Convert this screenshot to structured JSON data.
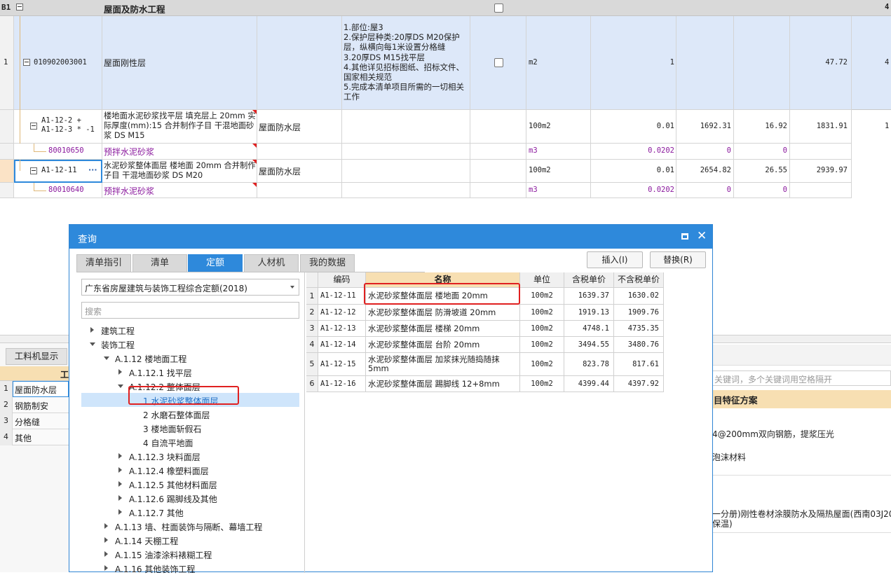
{
  "top_table": {
    "section": {
      "num": "B1",
      "name": "屋面及防水工程",
      "right_partial": "4"
    },
    "row1": {
      "num": "1",
      "code": "010902003001",
      "name": "屋面刚性层",
      "features": "1.部位:屋3\n2.保护层种类:20厚DS M20保护层，纵横向每1米设置分格缝\n3.20厚DS M15找平层\n4.其他详见招标图纸、招标文件、国家相关规范\n5.完成本清单项目所需的一切相关工作",
      "unit": "m2",
      "qty": "1",
      "price": "47.72",
      "right_partial": "4"
    },
    "row2": {
      "code": "A1-12-2 +\nA1-12-3 * -1",
      "name": "楼地面水泥砂浆找平层 填充层上 20mm 实际厚度(mm):15  合并制作子目 干混地面砂浆 DS M15",
      "spec": "屋面防水层",
      "unit": "100m2",
      "qty": "0.01",
      "p1": "1692.31",
      "p2": "16.92",
      "p3": "1831.91",
      "right_partial": "1"
    },
    "row3": {
      "code": "80010650",
      "name": "预拌水泥砂浆",
      "unit": "m3",
      "qty": "0.0202",
      "p1": "0",
      "p2": "0"
    },
    "row4": {
      "code": "A1-12-11",
      "more": "···",
      "name": "水泥砂浆整体面层 楼地面 20mm  合并制作子目 干混地面砂浆 DS M20",
      "spec": "屋面防水层",
      "unit": "100m2",
      "qty": "0.01",
      "p1": "2654.82",
      "p2": "26.55",
      "p3": "2939.97"
    },
    "row5": {
      "code": "80010640",
      "name": "预拌水泥砂浆",
      "unit": "m3",
      "qty": "0.0202",
      "p1": "0",
      "p2": "0"
    }
  },
  "lower_left": {
    "tab": "工料机显示",
    "header_partial": "工",
    "rows": [
      {
        "num": "1",
        "name": "屋面防水层"
      },
      {
        "num": "2",
        "name": "钢筋制安"
      },
      {
        "num": "3",
        "name": "分格缝"
      },
      {
        "num": "4",
        "name": "其他"
      }
    ]
  },
  "lower_right": {
    "search_hint": "关键词，多个关键词用空格隔开",
    "header": "目特征方案",
    "line1": "4@200mm双向钢筋，提浆压光",
    "line2": "泡沫材料",
    "line3": "一分册)刚性卷材涂膜防水及隔热屋面(西南03J201",
    "line4": "保温)"
  },
  "dialog": {
    "title": "查询",
    "tabs": [
      "清单指引",
      "清单",
      "定额",
      "人材机",
      "我的数据"
    ],
    "active_tab": 2,
    "insert_btn": "插入(I)",
    "replace_btn": "替换(R)",
    "norm_select": "广东省房屋建筑与装饰工程综合定额(2018)",
    "search_placeholder": "搜索",
    "tree": [
      {
        "label": "建筑工程",
        "level": 0,
        "state": "closed"
      },
      {
        "label": "装饰工程",
        "level": 0,
        "state": "open"
      },
      {
        "label": "A.1.12 楼地面工程",
        "level": 1,
        "state": "open"
      },
      {
        "label": "A.1.12.1 找平层",
        "level": 2,
        "state": "closed"
      },
      {
        "label": "A.1.12.2 整体面层",
        "level": 2,
        "state": "open"
      },
      {
        "label": "1 水泥砂浆整体面层",
        "level": 3,
        "state": "leaf",
        "selected": true
      },
      {
        "label": "2 水磨石整体面层",
        "level": 3,
        "state": "leaf"
      },
      {
        "label": "3 楼地面斩假石",
        "level": 3,
        "state": "leaf"
      },
      {
        "label": "4 自流平地面",
        "level": 3,
        "state": "leaf"
      },
      {
        "label": "A.1.12.3 块料面层",
        "level": 2,
        "state": "closed"
      },
      {
        "label": "A.1.12.4 橡塑料面层",
        "level": 2,
        "state": "closed"
      },
      {
        "label": "A.1.12.5 其他材料面层",
        "level": 2,
        "state": "closed"
      },
      {
        "label": "A.1.12.6 踢脚线及其他",
        "level": 2,
        "state": "closed"
      },
      {
        "label": "A.1.12.7 其他",
        "level": 2,
        "state": "closed"
      },
      {
        "label": "A.1.13 墙、柱面装饰与隔断、幕墙工程",
        "level": 1,
        "state": "closed"
      },
      {
        "label": "A.1.14 天棚工程",
        "level": 1,
        "state": "closed"
      },
      {
        "label": "A.1.15 油漆涂料裱糊工程",
        "level": 1,
        "state": "closed"
      },
      {
        "label": "A.1.16 其他装饰工程",
        "level": 1,
        "state": "closed"
      }
    ],
    "grid_headers": [
      "编码",
      "名称",
      "单位",
      "含税单价",
      "不含税单价"
    ],
    "grid_rows": [
      {
        "num": "1",
        "code": "A1-12-11",
        "name": "水泥砂浆整体面层 楼地面 20mm",
        "unit": "100m2",
        "tax": "1639.37",
        "notax": "1630.02"
      },
      {
        "num": "2",
        "code": "A1-12-12",
        "name": "水泥砂浆整体面层 防滑坡道 20mm",
        "unit": "100m2",
        "tax": "1919.13",
        "notax": "1909.76"
      },
      {
        "num": "3",
        "code": "A1-12-13",
        "name": "水泥砂浆整体面层 楼梯 20mm",
        "unit": "100m2",
        "tax": "4748.1",
        "notax": "4735.35"
      },
      {
        "num": "4",
        "code": "A1-12-14",
        "name": "水泥砂浆整体面层 台阶 20mm",
        "unit": "100m2",
        "tax": "3494.55",
        "notax": "3480.76"
      },
      {
        "num": "5",
        "code": "A1-12-15",
        "name": "水泥砂浆整体面层 加浆抹光随捣随抹 5mm",
        "unit": "100m2",
        "tax": "823.78",
        "notax": "817.61"
      },
      {
        "num": "6",
        "code": "A1-12-16",
        "name": "水泥砂浆整体面层 踢脚线 12+8mm",
        "unit": "100m2",
        "tax": "4399.44",
        "notax": "4397.92"
      }
    ],
    "highlight_color": "#e02020",
    "accent_color": "#2e89db"
  }
}
